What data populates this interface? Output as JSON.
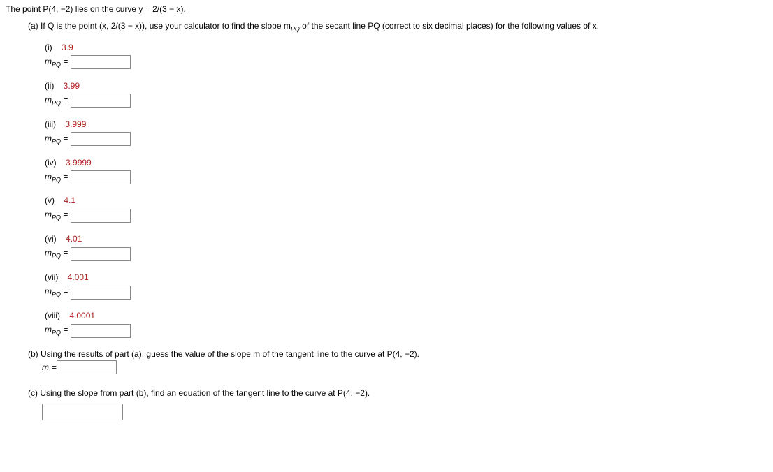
{
  "intro": "The point  P(4, −2)  lies on the curve  y = 2/(3 − x).",
  "partA": "(a) If Q is the point  (x, 2/(3 − x)),  use your calculator to find the slope  m",
  "partA_sub": "PQ",
  "partA_tail": "  of the secant line PQ (correct to six decimal places) for the following values of x.",
  "mpq_prefix": "m",
  "mpq_sub": "PQ",
  "eq": " = ",
  "items": [
    {
      "roman": "(i)",
      "x": "3.9"
    },
    {
      "roman": "(ii)",
      "x": "3.99"
    },
    {
      "roman": "(iii)",
      "x": "3.999"
    },
    {
      "roman": "(iv)",
      "x": "3.9999"
    },
    {
      "roman": "(v)",
      "x": "4.1"
    },
    {
      "roman": "(vi)",
      "x": "4.01"
    },
    {
      "roman": "(vii)",
      "x": "4.001"
    },
    {
      "roman": "(viii)",
      "x": "4.0001"
    }
  ],
  "partB": "(b) Using the results of part (a), guess the value of the slope m of the tangent line to the curve at  P(4, −2).",
  "m_label": "m",
  "partC": "(c) Using the slope from part (b), find an equation of the tangent line to the curve at  P(4, −2)."
}
